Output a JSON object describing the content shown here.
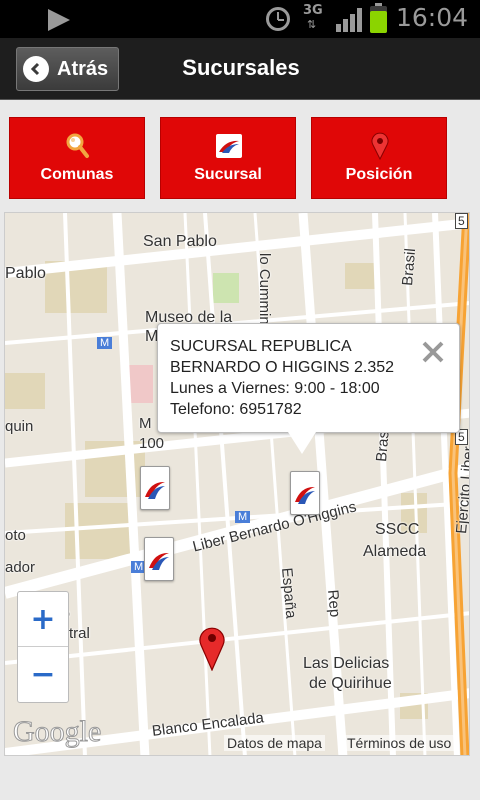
{
  "status_bar": {
    "time": "16:04",
    "network": "3G",
    "network_arrows": "⇅",
    "battery_level": 0.8
  },
  "header": {
    "back_label": "Atrás",
    "title": "Sucursales"
  },
  "tabs": [
    {
      "label": "Comunas",
      "icon": "magnifier-icon"
    },
    {
      "label": "Sucursal",
      "icon": "bank-logo-icon"
    },
    {
      "label": "Posición",
      "icon": "map-pin-icon"
    }
  ],
  "map": {
    "labels": {
      "san_pablo": "San Pablo",
      "pablo": "Pablo",
      "cumming": "lo Cumming",
      "brasil_top": "Brasil",
      "museo": "Museo de la",
      "museo2": "M",
      "quin": "quin",
      "m_100": "M",
      "num_100": "100",
      "brasil_mid": "Brasil",
      "oto": "oto",
      "ador": "ador",
      "liber": "Liber Bernardo O'Higgins",
      "sscc": "SSCC",
      "alameda": "Alameda",
      "espana": "España",
      "rep": "Rep",
      "ejercito": "Ejercito Liber",
      "ado": "ado",
      "tral": "tral",
      "delicias": "Las Delicias",
      "quirihue": "de Quirihue",
      "encalada": "Blanco Encalada",
      "route5_top": "5",
      "route5_mid": "5",
      "metro1": "M",
      "metro2": "M",
      "metro3": "M"
    },
    "popup": {
      "line1": "SUCURSAL REPUBLICA",
      "line2": "BERNARDO O HIGGINS 2.352",
      "line3": "Lunes a Viernes: 9:00 - 18:00",
      "line4": "Telefono: 6951782"
    },
    "zoom_in": "+",
    "zoom_out": "−",
    "google": "Google",
    "footer": {
      "data_link": "Datos de mapa",
      "terms_link": "Términos de uso"
    }
  },
  "colors": {
    "accent_red": "#e00707",
    "header_bg": "#1e1e1e",
    "map_bg": "#ebe6dc"
  }
}
